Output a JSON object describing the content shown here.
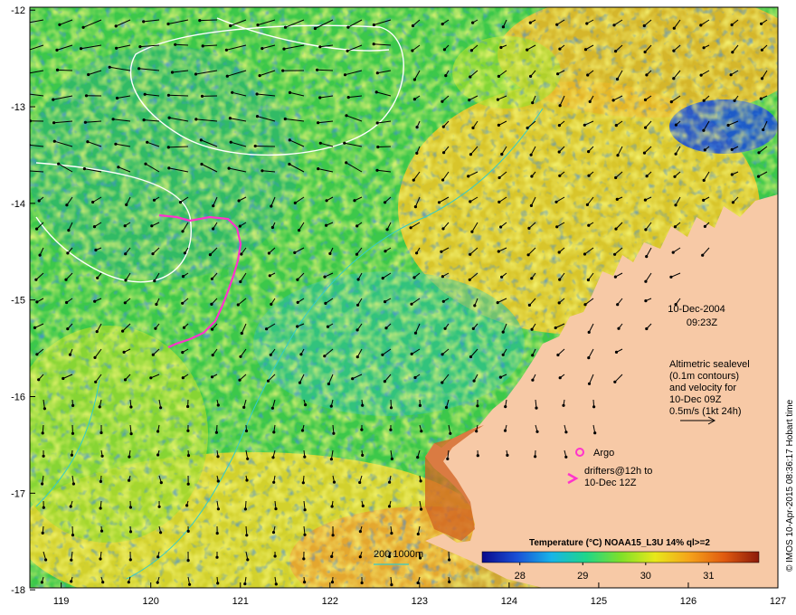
{
  "map": {
    "date_label": "10-Dec-2004",
    "time_label": "09:23Z",
    "altimetry_lines": [
      "Altimetric sealevel",
      "(0.1m contours)",
      "and velocity for",
      "10-Dec 09Z",
      "0.5m/s (1kt 24h)"
    ],
    "argo_label": "Argo",
    "drifters_lines": [
      "drifters@12h to",
      "10-Dec 12Z"
    ],
    "depth_label": "200  1000m",
    "colorbar_title": "Temperature (°C) NOAA15_L3U 14% ql>=2",
    "colorbar_ticks": [
      "28",
      "29",
      "30",
      "31"
    ],
    "colorbar_range": [
      27.4,
      31.8
    ],
    "credit": "© IMOS 10-Apr-2015 08:36:17 Hobart time",
    "lon_ticks": [
      "119",
      "120",
      "121",
      "122",
      "123",
      "124",
      "125",
      "126",
      "127"
    ],
    "lat_ticks": [
      "-12",
      "-13",
      "-14",
      "-15",
      "-16",
      "-17",
      "-18"
    ],
    "lon_range": [
      118.65,
      127
    ],
    "lat_range": [
      -17.98,
      -11.97
    ],
    "colors": {
      "land": "#f7c9a6",
      "drifter_track": "#ff33cc",
      "argo_marker": "#ff33cc",
      "depth_contour": "#33cccc",
      "sealevel_contour": "#ffffff",
      "velocity_arrow": "#000000"
    },
    "colorbar_stops": [
      "#0a0a8c",
      "#1a4fd6",
      "#18b4e8",
      "#1ed68a",
      "#7ee02a",
      "#e8e81a",
      "#f5a21a",
      "#e05a10",
      "#8c1a0a"
    ]
  }
}
